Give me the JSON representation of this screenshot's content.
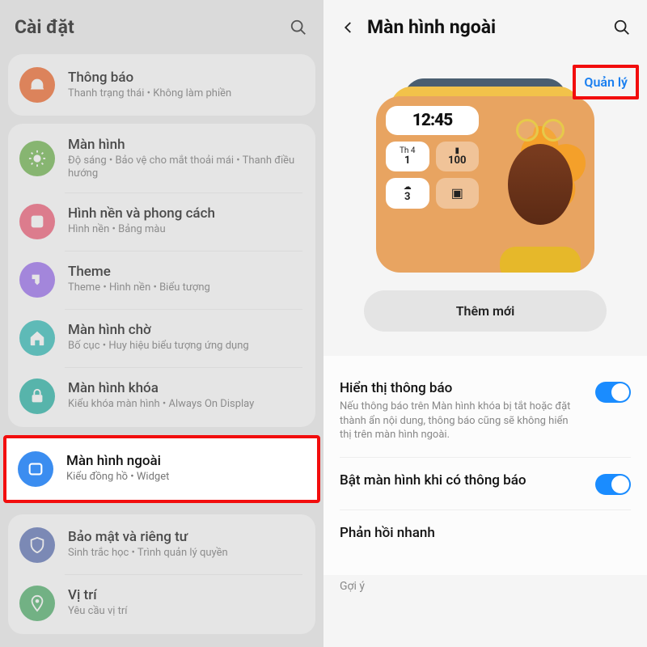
{
  "left": {
    "title": "Cài đặt",
    "groups": [
      [
        {
          "icon": "orange",
          "name": "notifications",
          "label": "Thông báo",
          "sub": "Thanh trạng thái  •  Không làm phiền"
        }
      ],
      [
        {
          "icon": "green",
          "name": "display",
          "label": "Màn hình",
          "sub": "Độ sáng  •  Bảo vệ cho mắt thoải mái  •  Thanh điều hướng"
        },
        {
          "icon": "pink",
          "name": "wallpaper",
          "label": "Hình nền và phong cách",
          "sub": "Hình nền  •  Bảng màu"
        },
        {
          "icon": "purple",
          "name": "theme",
          "label": "Theme",
          "sub": "Theme  •  Hình nền  •  Biểu tượng"
        },
        {
          "icon": "teal",
          "name": "home",
          "label": "Màn hình chờ",
          "sub": "Bố cục  •  Huy hiệu biểu tượng ứng dụng"
        },
        {
          "icon": "teal2",
          "name": "lock",
          "label": "Màn hình khóa",
          "sub": "Kiểu khóa màn hình  •  Always On Display"
        }
      ],
      [
        {
          "icon": "blue",
          "name": "cover",
          "label": "Màn hình ngoài",
          "sub": "Kiểu đồng hồ  •  Widget"
        }
      ],
      [
        {
          "icon": "navy",
          "name": "privacy",
          "label": "Bảo mật và riêng tư",
          "sub": "Sinh trắc học  •  Trình quản lý quyền"
        },
        {
          "icon": "green2",
          "name": "location",
          "label": "Vị trí",
          "sub": "Yêu cầu vị trí"
        }
      ]
    ]
  },
  "right": {
    "title": "Màn hình ngoài",
    "manage": "Quản lý",
    "clock": "12:45",
    "tile_day_label": "Th 4",
    "tile_day_num": "1",
    "tile_batt": "100",
    "tile_weather": "3",
    "add": "Thêm mới",
    "opt1": {
      "t": "Hiển thị thông báo",
      "s": "Nếu thông báo trên Màn hình khóa bị tắt hoặc đặt thành ẩn nội dung, thông báo cũng sẽ không hiển thị trên màn hình ngoài."
    },
    "opt2": {
      "t": "Bật màn hình khi có thông báo"
    },
    "opt3": {
      "t": "Phản hồi nhanh"
    },
    "tip": "Gợi ý"
  }
}
